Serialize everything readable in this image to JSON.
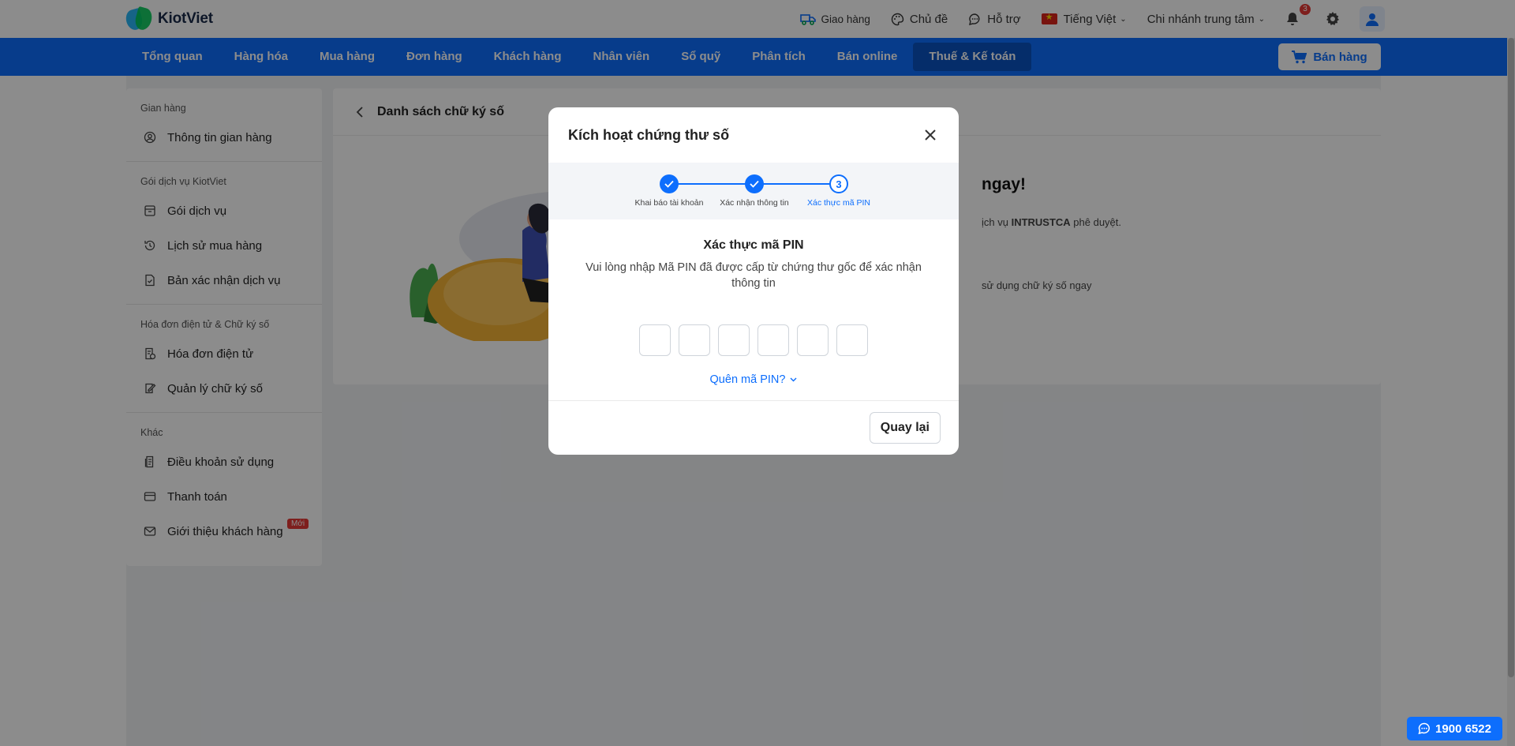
{
  "header": {
    "logo_text": "KiotViet",
    "delivery_label": "Giao hàng",
    "theme_label": "Chủ đề",
    "support_label": "Hỗ trợ",
    "language_label": "Tiếng Việt",
    "branch_label": "Chi nhánh trung tâm",
    "notification_count": "3"
  },
  "nav": {
    "items": [
      {
        "label": "Tổng quan"
      },
      {
        "label": "Hàng hóa"
      },
      {
        "label": "Mua hàng"
      },
      {
        "label": "Đơn hàng"
      },
      {
        "label": "Khách hàng"
      },
      {
        "label": "Nhân viên"
      },
      {
        "label": "Sổ quỹ"
      },
      {
        "label": "Phân tích"
      },
      {
        "label": "Bán online"
      },
      {
        "label": "Thuế & Kế toán"
      }
    ],
    "active_index": 9,
    "sell_label": "Bán hàng"
  },
  "sidebar": {
    "groups": [
      {
        "title": "Gian hàng",
        "items": [
          {
            "label": "Thông tin gian hàng",
            "icon": "user-circle-icon"
          }
        ]
      },
      {
        "title": "Gói dịch vụ KiotViet",
        "items": [
          {
            "label": "Gói dịch vụ",
            "icon": "store-icon"
          },
          {
            "label": "Lịch sử mua hàng",
            "icon": "history-icon"
          },
          {
            "label": "Bản xác nhận dịch vụ",
            "icon": "document-check-icon"
          }
        ]
      },
      {
        "title": "Hóa đơn điện tử & Chữ ký số",
        "items": [
          {
            "label": "Hóa đơn điện tử",
            "icon": "invoice-icon"
          },
          {
            "label": "Quản lý chữ ký số",
            "icon": "signature-icon"
          }
        ]
      },
      {
        "title": "Khác",
        "items": [
          {
            "label": "Điều khoản sử dụng",
            "icon": "terms-icon"
          },
          {
            "label": "Thanh toán",
            "icon": "wallet-icon"
          },
          {
            "label": "Giới thiệu khách hàng",
            "icon": "mail-icon",
            "badge": "Mới"
          }
        ]
      }
    ]
  },
  "content": {
    "title": "Danh sách chữ ký số",
    "heading_tail": "ngay!",
    "line1_prefix": "ịch vụ ",
    "line1_bold": "INTRUSTCA",
    "line1_suffix": " phê duyệt.",
    "line2": "sử dụng chữ ký số ngay"
  },
  "modal": {
    "title": "Kích hoạt chứng thư số",
    "steps": [
      {
        "label": "Khai báo tài khoản",
        "state": "done"
      },
      {
        "label": "Xác nhận thông tin",
        "state": "done"
      },
      {
        "label": "Xác thực mã PIN",
        "state": "current",
        "number": "3"
      }
    ],
    "subtitle": "Xác thực mã PIN",
    "description": "Vui lòng nhập Mã PIN đã được cấp từ chứng thư gốc để xác nhận thông tin",
    "pin_length": 6,
    "forgot_label": "Quên mã PIN?",
    "back_label": "Quay lại"
  },
  "hotline": {
    "label": "1900 6522"
  },
  "colors": {
    "primary": "#0d6efd",
    "nav_active": "#0a52c2",
    "badge": "#e53935"
  }
}
